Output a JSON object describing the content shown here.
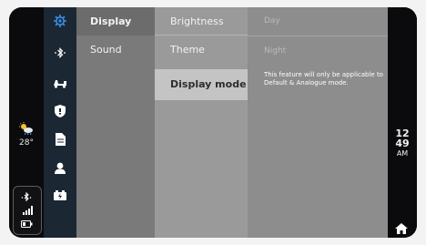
{
  "status": {
    "weather_icon": "cloud-sun-icon",
    "temperature": "28°",
    "bluetooth_icon": "bluetooth-icon",
    "signal_icon": "signal-icon",
    "battery_icon": "battery-icon"
  },
  "nav_icons": [
    {
      "name": "settings-gear-icon",
      "active": true
    },
    {
      "name": "bluetooth-icon"
    },
    {
      "name": "scooter-icon"
    },
    {
      "name": "shield-icon"
    },
    {
      "name": "document-icon"
    },
    {
      "name": "profile-icon"
    },
    {
      "name": "battery-charge-icon"
    }
  ],
  "categories": [
    {
      "label": "Display",
      "active": true
    },
    {
      "label": "Sound"
    }
  ],
  "submenu": [
    {
      "label": "Brightness"
    },
    {
      "label": "Theme"
    },
    {
      "label": "Display mode",
      "active": true
    }
  ],
  "content": {
    "options": [
      "Day",
      "Night"
    ],
    "note": "This feature will only be applicable to Default & Analogue mode."
  },
  "clock": {
    "hour": "12",
    "minute": "49",
    "ampm": "AM"
  },
  "colors": {
    "accent": "#3a8fe8",
    "nav_bg": "#1b2733",
    "active_submenu_bg": "#c4c4c4"
  }
}
